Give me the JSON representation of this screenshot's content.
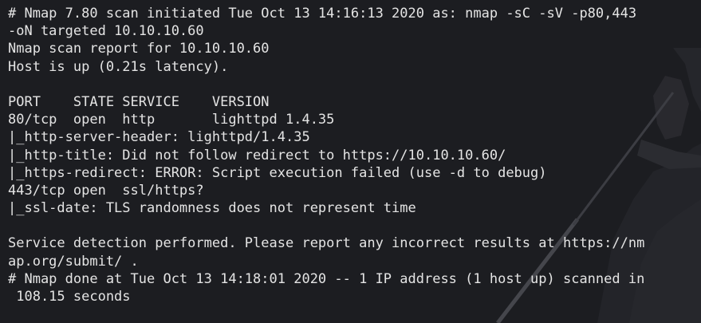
{
  "terminal": {
    "lines": [
      "# Nmap 7.80 scan initiated Tue Oct 13 14:16:13 2020 as: nmap -sC -sV -p80,443",
      "-oN targeted 10.10.10.60",
      "Nmap scan report for 10.10.10.60",
      "Host is up (0.21s latency).",
      "",
      "PORT    STATE SERVICE    VERSION",
      "80/tcp  open  http       lighttpd 1.4.35",
      "|_http-server-header: lighttpd/1.4.35",
      "|_http-title: Did not follow redirect to https://10.10.10.60/",
      "|_https-redirect: ERROR: Script execution failed (use -d to debug)",
      "443/tcp open  ssl/https?",
      "|_ssl-date: TLS randomness does not represent time",
      "",
      "Service detection performed. Please report any incorrect results at https://nm",
      "ap.org/submit/ .",
      "# Nmap done at Tue Oct 13 14:18:01 2020 -- 1 IP address (1 host up) scanned in",
      " 108.15 seconds"
    ],
    "colors": {
      "background": "#1c1d21",
      "foreground": "#e4e4e4"
    }
  }
}
